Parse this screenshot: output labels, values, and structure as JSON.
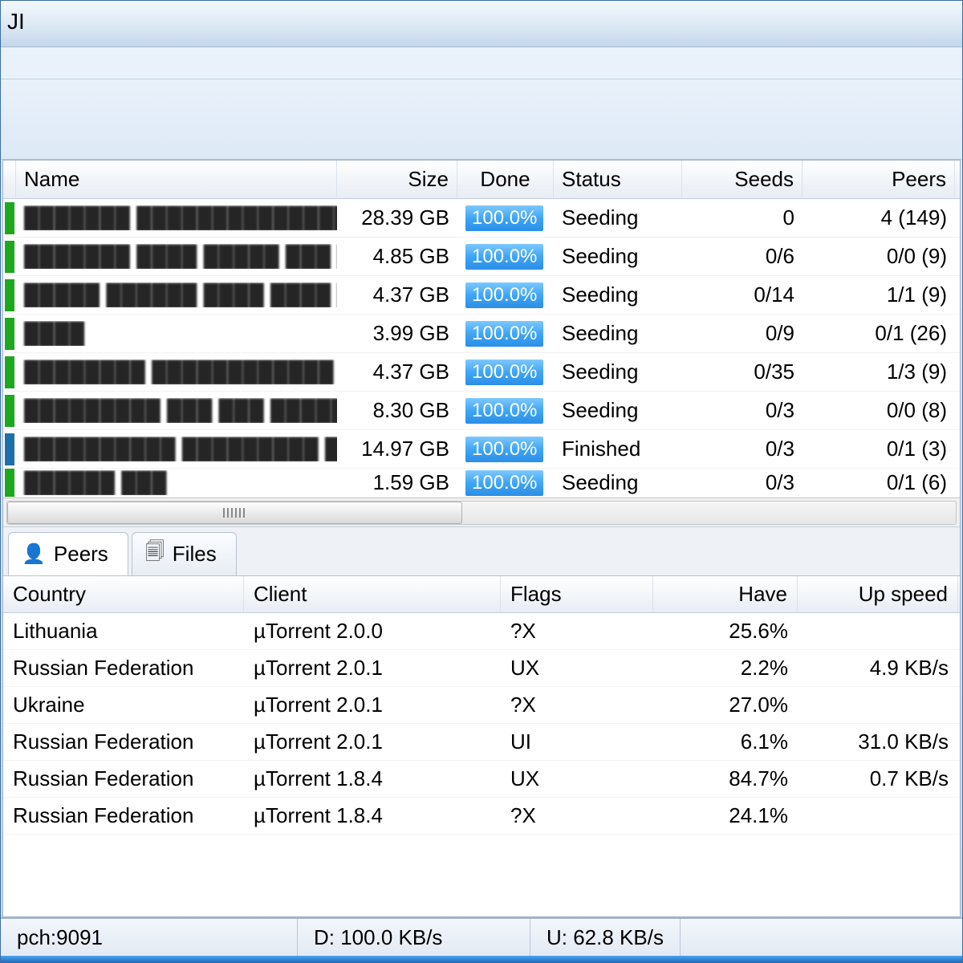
{
  "window": {
    "title_fragment": "JI"
  },
  "columns": {
    "name": "Name",
    "size": "Size",
    "done": "Done",
    "status": "Status",
    "seeds": "Seeds",
    "peers": "Peers"
  },
  "torrents": [
    {
      "name": "███████ ██████████████ █…",
      "size": "28.39 GB",
      "done": "100.0%",
      "status": "Seeding",
      "seeds": "0",
      "peers": "4 (149)"
    },
    {
      "name": "███████ ████ █████ ███ ███…",
      "size": "4.85 GB",
      "done": "100.0%",
      "status": "Seeding",
      "seeds": "0/6",
      "peers": "0/0 (9)"
    },
    {
      "name": "█████ ██████ ████ ████ █…",
      "size": "4.37 GB",
      "done": "100.0%",
      "status": "Seeding",
      "seeds": "0/14",
      "peers": "1/1 (9)"
    },
    {
      "name": "████",
      "size": "3.99 GB",
      "done": "100.0%",
      "status": "Seeding",
      "seeds": "0/9",
      "peers": "0/1 (26)"
    },
    {
      "name": "████████ ████████████ ███…",
      "size": "4.37 GB",
      "done": "100.0%",
      "status": "Seeding",
      "seeds": "0/35",
      "peers": "1/3 (9)"
    },
    {
      "name": "█████████ ███ ███ ██████ █",
      "size": "8.30 GB",
      "done": "100.0%",
      "status": "Seeding",
      "seeds": "0/3",
      "peers": "0/0 (8)"
    },
    {
      "name": "██████████ █████████ ████",
      "size": "14.97 GB",
      "done": "100.0%",
      "status": "Finished",
      "seeds": "0/3",
      "peers": "0/1 (3)"
    },
    {
      "name": "██████ ███",
      "size": "1.59 GB",
      "done": "100.0%",
      "status": "Seeding",
      "seeds": "0/3",
      "peers": "0/1 (6)"
    }
  ],
  "tabs": {
    "peers": "Peers",
    "files": "Files"
  },
  "peer_columns": {
    "country": "Country",
    "client": "Client",
    "flags": "Flags",
    "have": "Have",
    "up": "Up speed"
  },
  "peers": [
    {
      "country": "Lithuania",
      "client": "µTorrent 2.0.0",
      "flags": "?X",
      "have": "25.6%",
      "up": ""
    },
    {
      "country": "Russian Federation",
      "client": "µTorrent 2.0.1",
      "flags": "UX",
      "have": "2.2%",
      "up": "4.9 KB/s"
    },
    {
      "country": "Ukraine",
      "client": "µTorrent 2.0.1",
      "flags": "?X",
      "have": "27.0%",
      "up": ""
    },
    {
      "country": "Russian Federation",
      "client": "µTorrent 2.0.1",
      "flags": "UI",
      "have": "6.1%",
      "up": "31.0 KB/s"
    },
    {
      "country": "Russian Federation",
      "client": "µTorrent 1.8.4",
      "flags": "UX",
      "have": "84.7%",
      "up": "0.7 KB/s"
    },
    {
      "country": "Russian Federation",
      "client": "µTorrent 1.8.4",
      "flags": "?X",
      "have": "24.1%",
      "up": ""
    }
  ],
  "status": {
    "host": "pch:9091",
    "down": "D: 100.0 KB/s",
    "up": "U: 62.8 KB/s"
  }
}
